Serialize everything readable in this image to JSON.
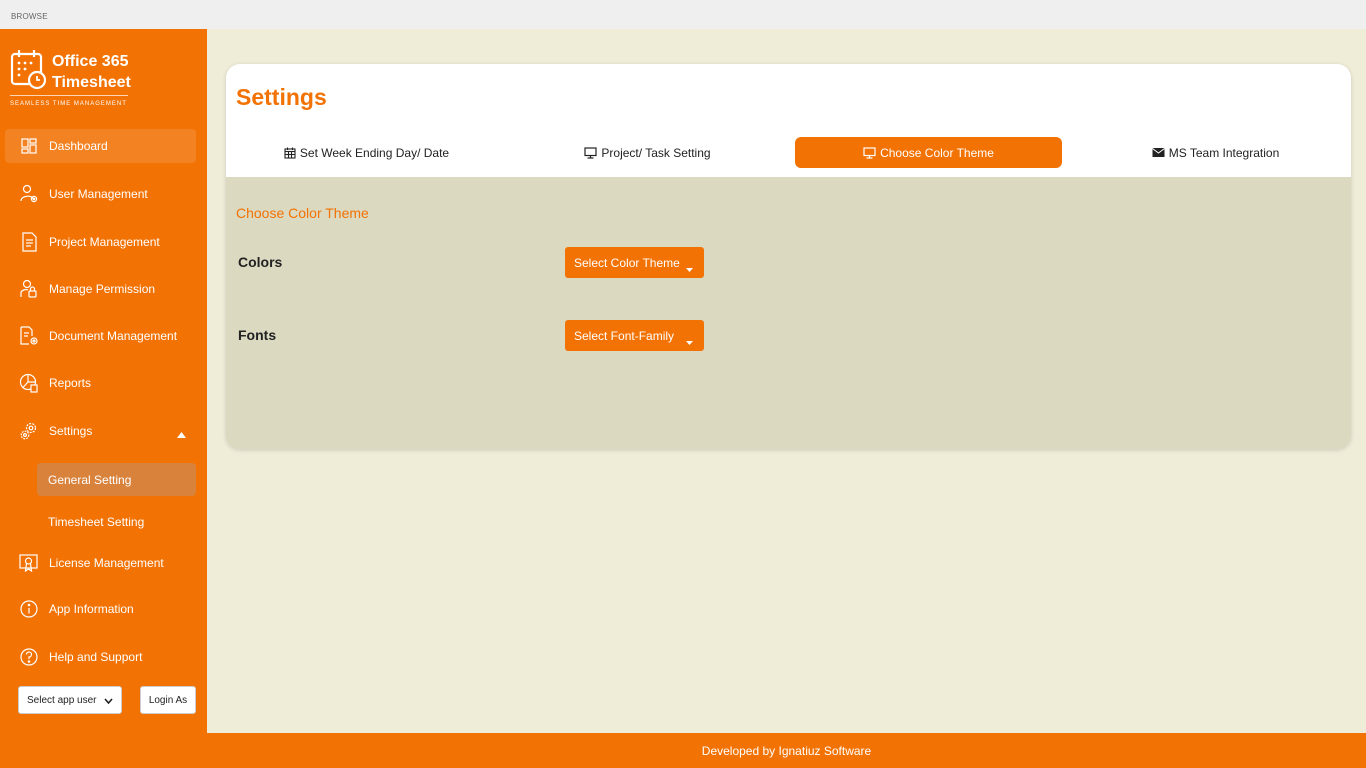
{
  "topbar": {
    "label": "BROWSE"
  },
  "brand": {
    "title_line1": "Office 365",
    "title_line2": "Timesheet",
    "tagline": "SEAMLESS TIME MANAGEMENT"
  },
  "sidebar": {
    "items": [
      {
        "label": "Dashboard",
        "icon": "dashboard-icon"
      },
      {
        "label": "User Management",
        "icon": "user-gear-icon"
      },
      {
        "label": "Project Management",
        "icon": "document-icon"
      },
      {
        "label": "Manage Permission",
        "icon": "permission-icon"
      },
      {
        "label": "Document Management",
        "icon": "document-gear-icon"
      },
      {
        "label": "Reports",
        "icon": "reports-icon"
      },
      {
        "label": "Settings",
        "icon": "gear-icon"
      },
      {
        "label": "License Management",
        "icon": "license-icon"
      },
      {
        "label": "App Information",
        "icon": "info-icon"
      },
      {
        "label": "Help and Support",
        "icon": "help-icon"
      }
    ],
    "subitems": [
      {
        "label": "General Setting"
      },
      {
        "label": "Timesheet Setting"
      }
    ],
    "user_select": "Select app user",
    "login_button": "Login As"
  },
  "main": {
    "title": "Settings",
    "tabs": [
      {
        "label": "Set Week Ending Day/ Date",
        "icon": "calendar-icon"
      },
      {
        "label": "Project/ Task Setting",
        "icon": "monitor-icon"
      },
      {
        "label": "Choose Color Theme",
        "icon": "monitor-icon"
      },
      {
        "label": "MS Team Integration",
        "icon": "envelope-icon"
      }
    ],
    "section_title": "Choose Color Theme",
    "colors_label": "Colors",
    "colors_dropdown": "Select Color Theme",
    "fonts_label": "Fonts",
    "fonts_dropdown": "Select Font-Family"
  },
  "footer": {
    "text": "Developed by Ignatiuz Software"
  },
  "colors": {
    "accent": "#f27204",
    "background": "#efecd8",
    "panel": "#dcd9c1"
  }
}
